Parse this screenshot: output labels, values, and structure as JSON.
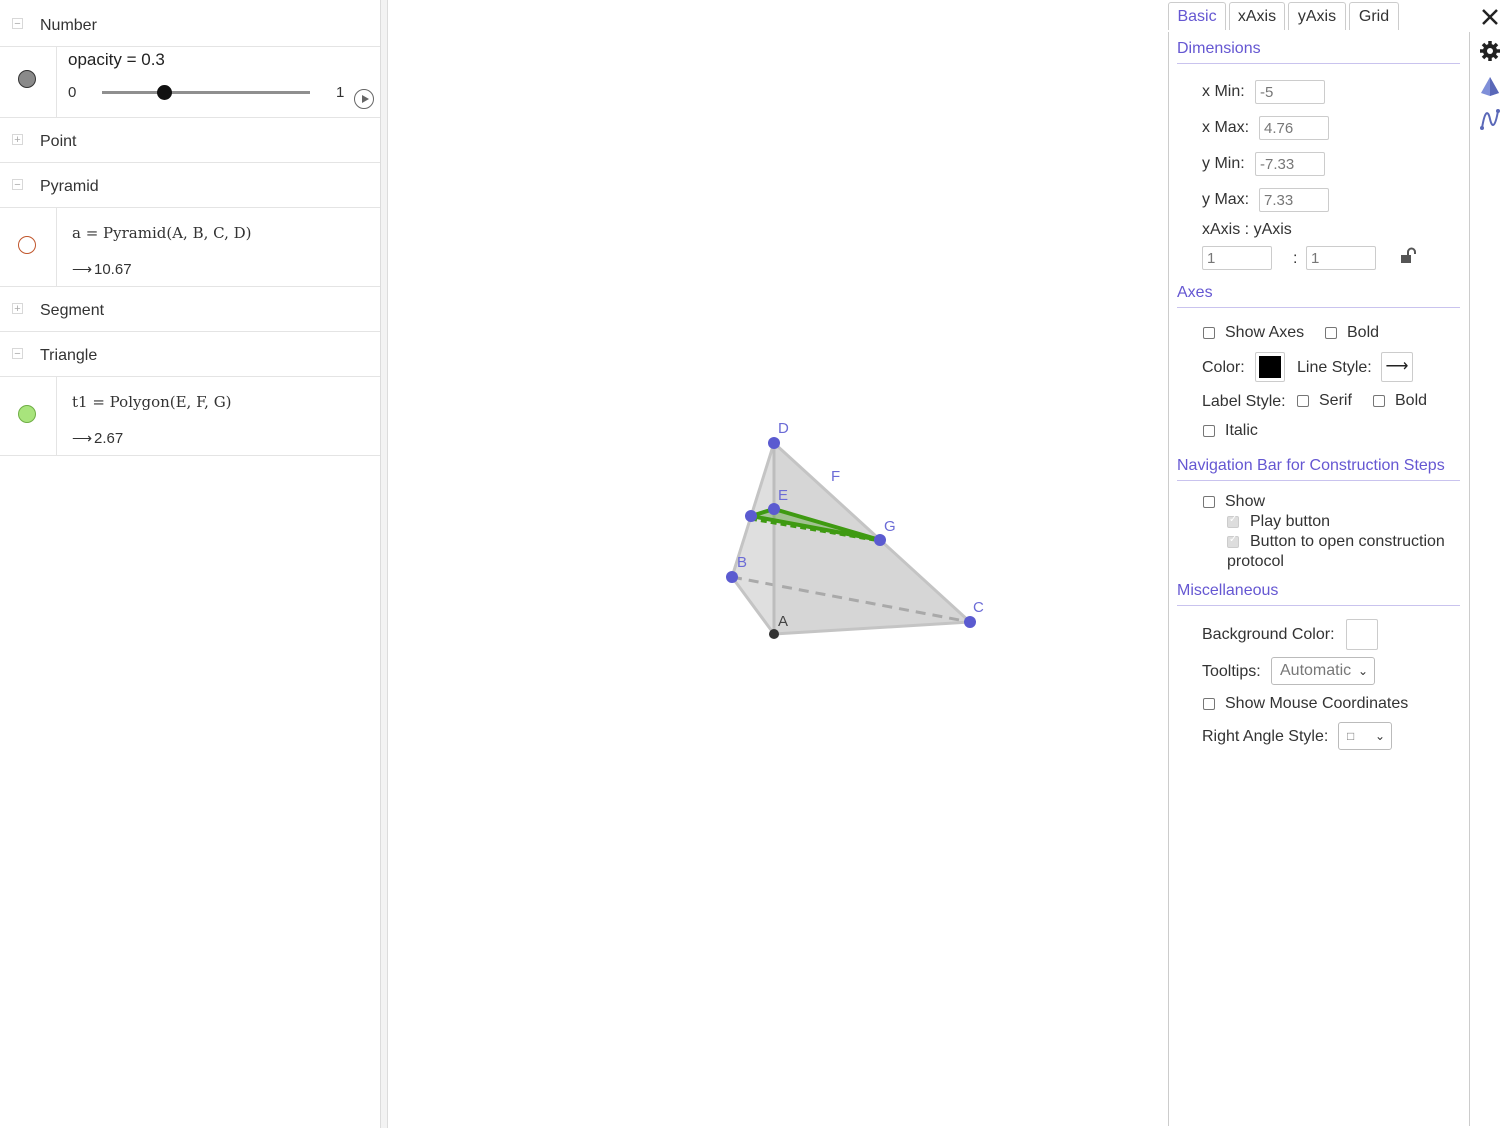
{
  "algebra": {
    "groups": {
      "number": {
        "label": "Number",
        "toggle": "−"
      },
      "point": {
        "label": "Point",
        "toggle": "+"
      },
      "pyramid": {
        "label": "Pyramid",
        "toggle": "−"
      },
      "segment": {
        "label": "Segment",
        "toggle": "+"
      },
      "triangle": {
        "label": "Triangle",
        "toggle": "−"
      }
    },
    "slider": {
      "caption": "opacity = 0.3",
      "min": "0",
      "max": "1",
      "value": 0.3,
      "marble_color": "#8a8a8a"
    },
    "pyramid_item": {
      "formula": "a  =  Pyramid(A, B, C, D)",
      "arrow": "⟶",
      "result": "10.67",
      "marble_color": "#c0562c"
    },
    "triangle_item": {
      "formula": "t1  =  Polygon(E, F, G)",
      "arrow": "⟶",
      "result": "2.67",
      "marble_color": "#a8e47c"
    }
  },
  "graphics": {
    "point_labels": {
      "A": "A",
      "B": "B",
      "C": "C",
      "D": "D",
      "E": "E",
      "F": "F",
      "G": "G"
    },
    "colors": {
      "point": "#5b5bd0",
      "face": "#d8d8d8",
      "edge": "#bdbdbd",
      "triangle": "#3f9a12",
      "label": "#6b6bd6"
    }
  },
  "properties": {
    "tabs": [
      "Basic",
      "xAxis",
      "yAxis",
      "Grid"
    ],
    "active_tab": "Basic",
    "close_icon": "close-icon",
    "dimensions": {
      "title": "Dimensions",
      "xmin_label": "x Min:",
      "xmin": "-5",
      "xmax_label": "x Max:",
      "xmax": "4.76",
      "ymin_label": "y Min:",
      "ymin": "-7.33",
      "ymax_label": "y Max:",
      "ymax": "7.33",
      "ratio_label": "xAxis : yAxis",
      "ratio_x": "1",
      "ratio_sep": ":",
      "ratio_y": "1"
    },
    "axes": {
      "title": "Axes",
      "show_axes": "Show Axes",
      "bold": "Bold",
      "color_label": "Color:",
      "color": "#000000",
      "line_style_label": "Line Style:",
      "line_style_glyph": "⟶",
      "label_style_label": "Label Style:",
      "serif": "Serif",
      "bold2": "Bold",
      "italic": "Italic"
    },
    "navbar": {
      "title": "Navigation Bar for Construction Steps",
      "show": "Show",
      "play_button": "Play button",
      "protocol_button_1": "Button to open construction",
      "protocol_button_2": "protocol"
    },
    "misc": {
      "title": "Miscellaneous",
      "bg_color_label": "Background Color:",
      "bg_color": "#ffffff",
      "tooltips_label": "Tooltips:",
      "tooltips_value": "Automatic",
      "mouse_coords": "Show Mouse Coordinates",
      "right_angle_label": "Right Angle Style:",
      "right_angle_value": "□"
    }
  }
}
